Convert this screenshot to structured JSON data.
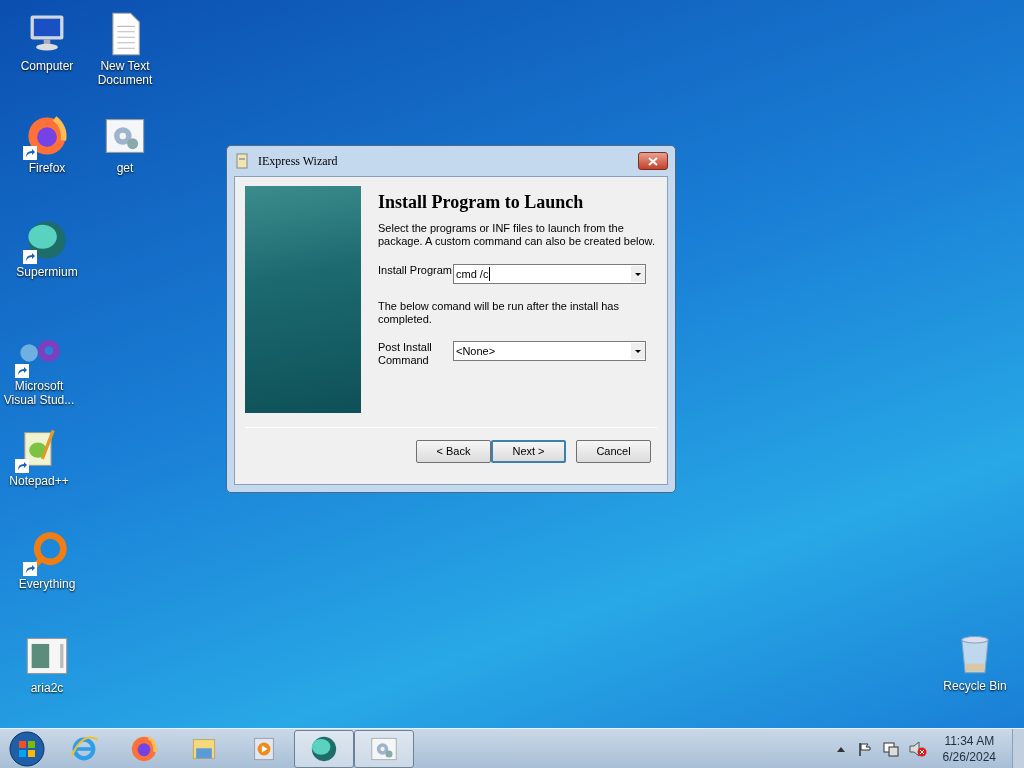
{
  "desktop_icons": [
    {
      "label": "Computer",
      "kind": "computer",
      "shortcut": false
    },
    {
      "label": "New Text Document",
      "kind": "document",
      "shortcut": false
    },
    {
      "label": "Firefox",
      "kind": "firefox",
      "shortcut": true
    },
    {
      "label": "get",
      "kind": "setup",
      "shortcut": false
    },
    {
      "label": "Supermium",
      "kind": "supermium",
      "shortcut": true
    },
    {
      "label": "Microsoft Visual Stud...",
      "kind": "vs",
      "shortcut": true
    },
    {
      "label": "Notepad++",
      "kind": "notepad",
      "shortcut": true
    },
    {
      "label": "Everything",
      "kind": "everything",
      "shortcut": true
    },
    {
      "label": "aria2c",
      "kind": "app",
      "shortcut": false
    },
    {
      "label": "Recycle Bin",
      "kind": "bin",
      "shortcut": false
    }
  ],
  "window": {
    "title": "IExpress Wizard",
    "heading": "Install Program to Launch",
    "intro": "Select the programs or INF files to launch from the package.  A custom command can also be created below.",
    "install_label": "Install Program",
    "install_value": "cmd /c",
    "note": "The below comand will be run after the install has completed.",
    "post_label": "Post Install Command",
    "post_value": "<None>",
    "buttons": [
      {
        "label": "< Back",
        "default": false
      },
      {
        "label": "Next >",
        "default": true
      },
      {
        "label": "Cancel",
        "default": false
      }
    ]
  },
  "taskbar": {
    "items": [
      {
        "kind": "ie",
        "running": false
      },
      {
        "kind": "firefox",
        "running": false
      },
      {
        "kind": "explorer",
        "running": false
      },
      {
        "kind": "media",
        "running": false
      },
      {
        "kind": "supermium",
        "running": true
      },
      {
        "kind": "setup",
        "running": true
      }
    ],
    "time": "11:34 AM",
    "date": "6/26/2024"
  }
}
